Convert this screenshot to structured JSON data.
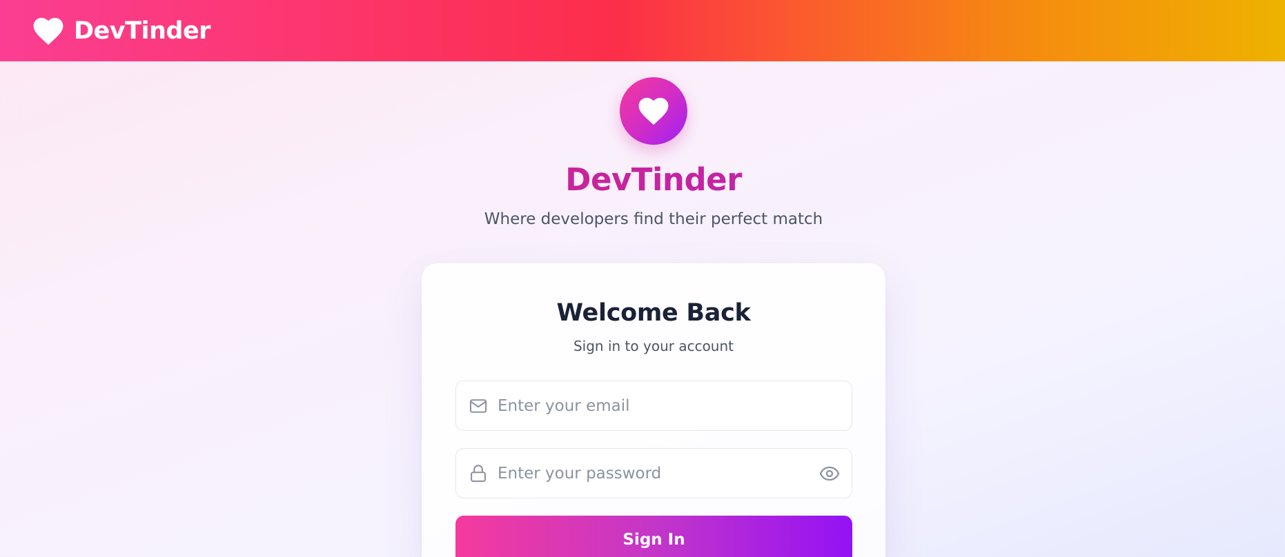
{
  "navbar": {
    "brand_name": "DevTinder",
    "brand_icon": "heart-icon",
    "gradient_colors": [
      "#fb3e93",
      "#fc2e4a",
      "#f68b0f",
      "#eeb200"
    ]
  },
  "hero": {
    "logo_icon": "heart-icon",
    "title": "DevTinder",
    "subtitle": "Where developers find their perfect match"
  },
  "login_card": {
    "title": "Welcome Back",
    "subtitle": "Sign in to your account",
    "email": {
      "icon": "mail-icon",
      "placeholder": "Enter your email",
      "value": ""
    },
    "password": {
      "icon": "lock-icon",
      "placeholder": "Enter your password",
      "value": "",
      "toggle_icon": "eye-icon"
    },
    "submit_label": "Sign In"
  },
  "colors": {
    "accent_pink": "#f53a9d",
    "accent_purple": "#9412f5",
    "title_magenta": "#c026b0",
    "heading_dark": "#1a2238"
  }
}
